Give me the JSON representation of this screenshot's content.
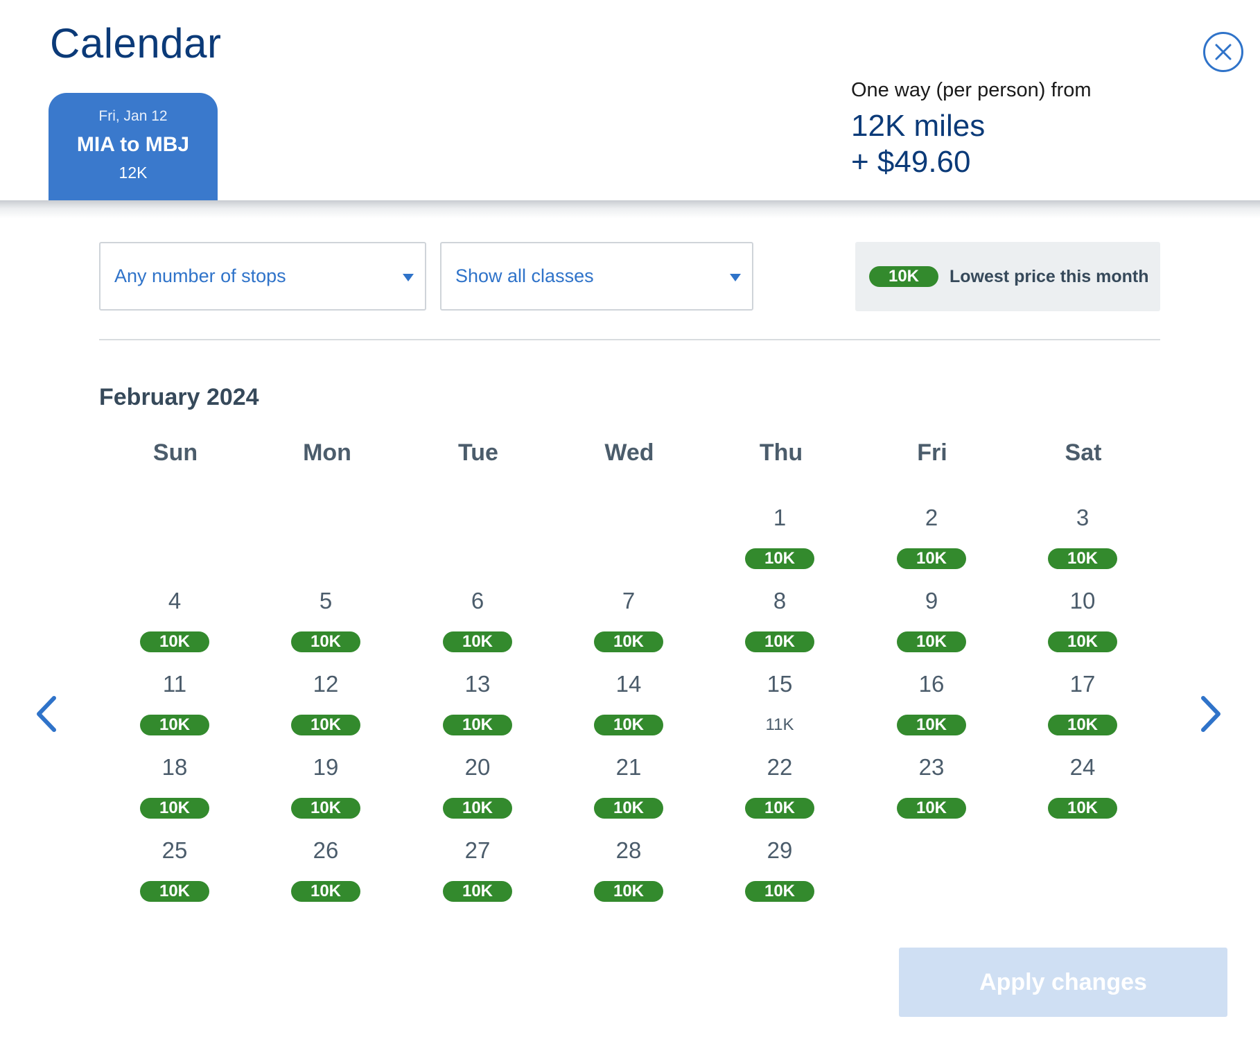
{
  "header": {
    "title": "Calendar",
    "close_icon": "close-circle-icon"
  },
  "flight_tab": {
    "date": "Fri, Jan 12",
    "route": "MIA to MBJ",
    "price": "12K"
  },
  "fare_summary": {
    "label": "One way (per person) from",
    "miles": "12K miles",
    "cash": "+ $49.60"
  },
  "filters": {
    "stops": {
      "value": "Any number of stops"
    },
    "classes": {
      "value": "Show all classes"
    }
  },
  "legend": {
    "badge": "10K",
    "text": "Lowest price this month"
  },
  "calendar": {
    "month": "February 2024",
    "weekdays": [
      "Sun",
      "Mon",
      "Tue",
      "Wed",
      "Thu",
      "Fri",
      "Sat"
    ],
    "days": [
      {
        "day": "1",
        "price": "10K",
        "lowest": true
      },
      {
        "day": "2",
        "price": "10K",
        "lowest": true
      },
      {
        "day": "3",
        "price": "10K",
        "lowest": true
      },
      {
        "day": "4",
        "price": "10K",
        "lowest": true
      },
      {
        "day": "5",
        "price": "10K",
        "lowest": true
      },
      {
        "day": "6",
        "price": "10K",
        "lowest": true
      },
      {
        "day": "7",
        "price": "10K",
        "lowest": true
      },
      {
        "day": "8",
        "price": "10K",
        "lowest": true
      },
      {
        "day": "9",
        "price": "10K",
        "lowest": true
      },
      {
        "day": "10",
        "price": "10K",
        "lowest": true
      },
      {
        "day": "11",
        "price": "10K",
        "lowest": true
      },
      {
        "day": "12",
        "price": "10K",
        "lowest": true
      },
      {
        "day": "13",
        "price": "10K",
        "lowest": true
      },
      {
        "day": "14",
        "price": "10K",
        "lowest": true
      },
      {
        "day": "15",
        "price": "11K",
        "lowest": false
      },
      {
        "day": "16",
        "price": "10K",
        "lowest": true
      },
      {
        "day": "17",
        "price": "10K",
        "lowest": true
      },
      {
        "day": "18",
        "price": "10K",
        "lowest": true
      },
      {
        "day": "19",
        "price": "10K",
        "lowest": true
      },
      {
        "day": "20",
        "price": "10K",
        "lowest": true
      },
      {
        "day": "21",
        "price": "10K",
        "lowest": true
      },
      {
        "day": "22",
        "price": "10K",
        "lowest": true
      },
      {
        "day": "23",
        "price": "10K",
        "lowest": true
      },
      {
        "day": "24",
        "price": "10K",
        "lowest": true
      },
      {
        "day": "25",
        "price": "10K",
        "lowest": true
      },
      {
        "day": "26",
        "price": "10K",
        "lowest": true
      },
      {
        "day": "27",
        "price": "10K",
        "lowest": true
      },
      {
        "day": "28",
        "price": "10K",
        "lowest": true
      },
      {
        "day": "29",
        "price": "10K",
        "lowest": true
      }
    ],
    "prev_icon": "chevron-left-icon",
    "next_icon": "chevron-right-icon"
  },
  "footer": {
    "apply_label": "Apply changes"
  },
  "colors": {
    "brand_blue": "#0b3a78",
    "link_blue": "#2f73c9",
    "tab_blue": "#3a79cc",
    "lowest_green": "#338a2d",
    "disabled_button": "#cfdff3"
  }
}
